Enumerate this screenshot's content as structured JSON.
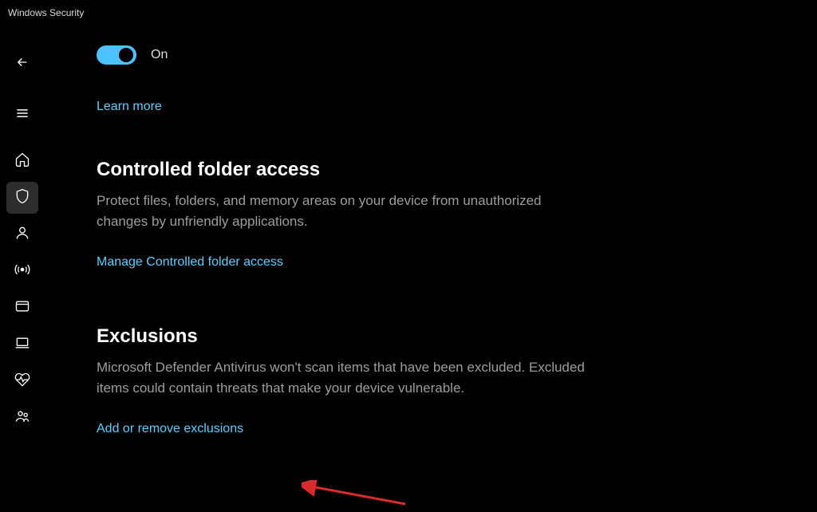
{
  "titlebar": {
    "title": "Windows Security"
  },
  "sidebar": {
    "items": [
      {
        "name": "back",
        "icon": "arrow-left"
      },
      {
        "name": "menu",
        "icon": "hamburger"
      },
      {
        "name": "home",
        "icon": "home"
      },
      {
        "name": "virus",
        "icon": "shield",
        "active": true
      },
      {
        "name": "account",
        "icon": "person"
      },
      {
        "name": "firewall",
        "icon": "signal"
      },
      {
        "name": "app-browser",
        "icon": "window"
      },
      {
        "name": "device-security",
        "icon": "laptop"
      },
      {
        "name": "performance",
        "icon": "heart"
      },
      {
        "name": "family",
        "icon": "people"
      }
    ]
  },
  "content": {
    "toggle": {
      "state": "on",
      "label": "On"
    },
    "learn_more": "Learn more",
    "sections": {
      "controlled_folder_access": {
        "title": "Controlled folder access",
        "desc": "Protect files, folders, and memory areas on your device from unauthorized changes by unfriendly applications.",
        "link": "Manage Controlled folder access"
      },
      "exclusions": {
        "title": "Exclusions",
        "desc": "Microsoft Defender Antivirus won't scan items that have been excluded. Excluded items could contain threats that make your device vulnerable.",
        "link": "Add or remove exclusions"
      }
    }
  },
  "colors": {
    "accent": "#4cc2ff",
    "link": "#60cdff",
    "text_muted": "#9d9d9d"
  }
}
